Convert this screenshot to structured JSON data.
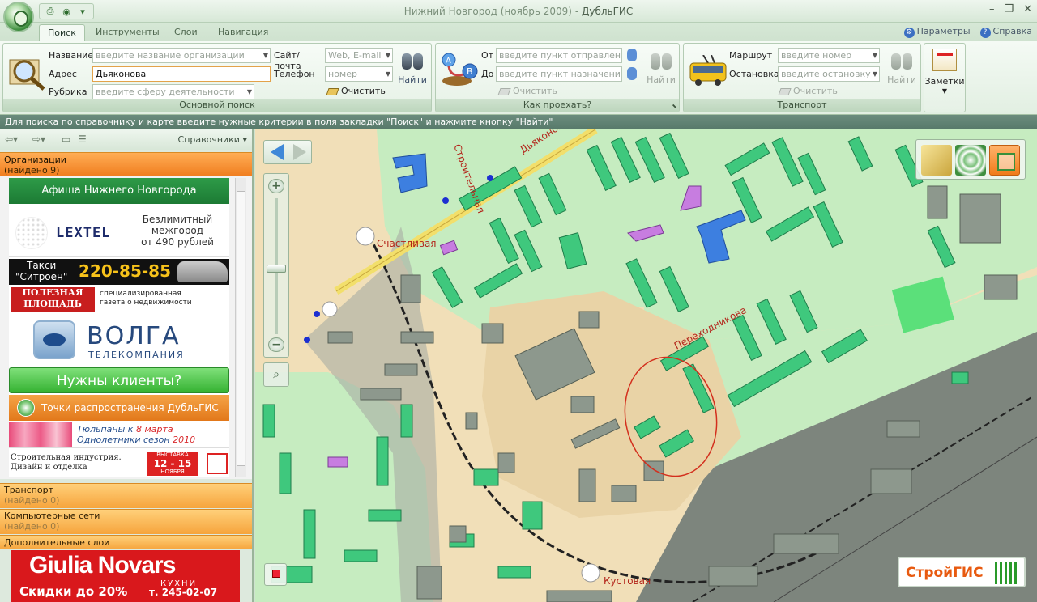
{
  "window": {
    "title_city": "Нижний Новгород (ноябрь 2009)",
    "title_sep": " - ",
    "title_app": "ДубльГИС",
    "qat_icons": [
      "printer-icon",
      "globe-icon",
      "dropdown-arrow-icon"
    ],
    "controls": [
      "minimize-icon",
      "restore-icon",
      "close-icon"
    ]
  },
  "tabs": [
    "Поиск",
    "Инструменты",
    "Слои",
    "Навигация"
  ],
  "active_tab": 0,
  "top_links": {
    "params": "Параметры",
    "help": "Справка"
  },
  "ribbon": {
    "search": {
      "name_label": "Название",
      "name_placeholder": "введите название организации",
      "address_label": "Адрес",
      "address_value": "Дьяконова",
      "rubric_label": "Рубрика",
      "rubric_placeholder": "введите сферу деятельности",
      "site_label": "Сайт/почта",
      "site_placeholder": "Web, E-mail",
      "phone_label": "Телефон",
      "phone_placeholder": "номер",
      "clear_label": "Очистить",
      "find_label": "Найти",
      "caption": "Основной поиск"
    },
    "route": {
      "from_label": "От",
      "from_placeholder": "введите пункт отправления",
      "to_label": "До",
      "to_placeholder": "введите пункт назначения",
      "clear_label": "Очистить",
      "find_label": "Найти",
      "caption": "Как проехать?"
    },
    "transport": {
      "route_label": "Маршрут",
      "route_placeholder": "введите номер",
      "stop_label": "Остановка",
      "stop_placeholder": "введите остановку",
      "clear_label": "Очистить",
      "find_label": "Найти",
      "caption": "Транспорт"
    },
    "notes_label": "Заметки"
  },
  "infobar": "Для поиска по справочнику и карте введите нужные критерии в поля закладки \"Поиск\" и нажмите кнопку \"Найти\"",
  "leftpanel": {
    "directories_label": "Справочники",
    "sections": [
      {
        "title": "Организации",
        "count": "(найдено 9)"
      },
      {
        "title": "Транспорт",
        "count": "(найдено 0)"
      },
      {
        "title": "Компьютерные сети",
        "count": "(найдено 0)"
      },
      {
        "title": "Дополнительные слои",
        "count": ""
      }
    ],
    "ads": {
      "afisha": "Афиша Нижнего Новгорода",
      "lextel_name": "LEXTEL",
      "lextel_l1": "Безлимитный",
      "lextel_l2": "межгород",
      "lextel_l3": "от 490 рублей",
      "taxi_l1": "Такси",
      "taxi_l2": "\"Ситроен\"",
      "taxi_phone": "220-85-85",
      "pp_l1": "ПОЛЕЗНАЯ",
      "pp_l2": "ПЛОЩАДЬ",
      "pp_r1": "специализированная",
      "pp_r2": "газета о недвижимости",
      "volga_name": "ВОЛГА",
      "volga_sub": "ТЕЛЕКОМПАНИЯ",
      "clients": "Нужны клиенты?",
      "points": "Точки распространения ДубльГИС",
      "tulip_l1a": "Тюльпаны к ",
      "tulip_l1b": "8 марта",
      "tulip_l2a": "Однолетники сезон ",
      "tulip_l2b": "2010",
      "stroy_l1": "Строительная индустрия.",
      "stroy_l2": "Дизайн и отделка",
      "stroy_b1": "ВЫСТАВКА",
      "stroy_b2": "12 - 15",
      "stroy_b3": "НОЯБРЯ"
    },
    "giulia": {
      "name": "Giulia Novars",
      "kitchen": "КУХНИ",
      "discount": "Скидки до 20%",
      "phone": "т. 245-02-07"
    }
  },
  "map": {
    "streets": [
      "Счастливая",
      "Переходникова",
      "Кустовая",
      "Дьяконова",
      "Строительная"
    ],
    "brand": "СтройГИС"
  }
}
